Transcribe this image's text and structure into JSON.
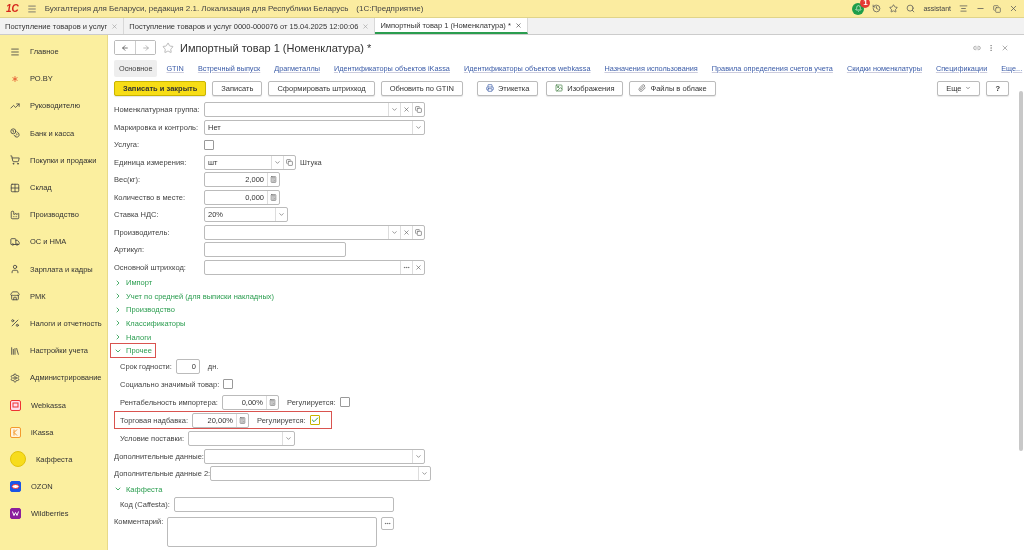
{
  "app_bar": {
    "logo": "1С",
    "title": "Бухгалтерия для Беларуси, редакция 2.1. Локализация для Республики Беларусь",
    "platform": "(1С:Предприятие)",
    "notification_count": "1",
    "user": "assistant"
  },
  "tabs": [
    {
      "label": "Поступление товаров и услуг",
      "selected": false
    },
    {
      "label": "Поступление товаров и услуг 0000-000076 от 15.04.2025 12:00:06",
      "selected": false
    },
    {
      "label": "Импортный товар 1 (Номенклатура) *",
      "selected": true
    }
  ],
  "sidebar": {
    "items": [
      {
        "label": "Главное"
      },
      {
        "label": "РО.BY"
      },
      {
        "label": "Руководителю"
      },
      {
        "label": "Банк и касса"
      },
      {
        "label": "Покупки и продажи"
      },
      {
        "label": "Склад"
      },
      {
        "label": "Производство"
      },
      {
        "label": "ОС и НМА"
      },
      {
        "label": "Зарплата и кадры"
      },
      {
        "label": "РМК"
      },
      {
        "label": "Налоги и отчетность"
      },
      {
        "label": "Настройки учета"
      },
      {
        "label": "Администрирование"
      },
      {
        "label": "Webkassa"
      },
      {
        "label": "iKassa"
      },
      {
        "label": "Каффеста"
      },
      {
        "label": "OZON"
      },
      {
        "label": "Wildberries"
      }
    ]
  },
  "form": {
    "title": "Импортный товар 1 (Номенклатура) *",
    "sections": [
      {
        "label": "Основное",
        "selected": true
      },
      {
        "label": "GTIN",
        "selected": false
      },
      {
        "label": "Встречный выпуск",
        "selected": false
      },
      {
        "label": "Драгметаллы",
        "selected": false
      },
      {
        "label": "Идентификаторы объектов iKassa",
        "selected": false
      },
      {
        "label": "Идентификаторы объектов webkassa",
        "selected": false
      },
      {
        "label": "Назначения использования",
        "selected": false
      },
      {
        "label": "Правила определения счетов учета",
        "selected": false
      },
      {
        "label": "Скидки номенклатуры",
        "selected": false
      },
      {
        "label": "Спецификации",
        "selected": false
      }
    ],
    "sections_more": "Еще...",
    "buttons": [
      {
        "label": "Записать и закрыть",
        "kind": "primary"
      },
      {
        "label": "Записать",
        "kind": "plain"
      },
      {
        "label": "Сформировать штрихкод",
        "kind": "plain"
      },
      {
        "label": "Обновить по GTIN",
        "kind": "plain"
      },
      {
        "label": "Этикетка",
        "kind": "print"
      },
      {
        "label": "Изображения",
        "kind": "image"
      },
      {
        "label": "Файлы в облаке",
        "kind": "clip"
      }
    ],
    "more_button": "Еще",
    "help_button": "?",
    "items": [
      {
        "kind": "ref",
        "label": "Номенклатурная группа:"
      },
      {
        "kind": "enum",
        "label": "Маркировка и контроль:",
        "value": "Нет"
      },
      {
        "kind": "check",
        "label": "Услуга:",
        "checked": false
      },
      {
        "kind": "unit",
        "label": "Единица измерения:",
        "value": "шт",
        "note": "Штука"
      },
      {
        "kind": "number",
        "label": "Вес(кг):",
        "value": "2,000"
      },
      {
        "kind": "number",
        "label": "Количество в месте:",
        "value": "0,000"
      },
      {
        "kind": "rate",
        "label": "Ставка НДС:",
        "value": "20%"
      },
      {
        "kind": "ref",
        "label": "Производитель:"
      },
      {
        "kind": "text",
        "label": "Артикул:"
      },
      {
        "kind": "barcode",
        "label": "Основной штрихкод:"
      },
      {
        "kind": "group",
        "label": "Импорт",
        "expanded": false,
        "highlighted": false
      },
      {
        "kind": "group",
        "label": "Учет по средней (для выписки накладных)",
        "expanded": false,
        "highlighted": false
      },
      {
        "kind": "group",
        "label": "Производство",
        "expanded": false,
        "highlighted": false
      },
      {
        "kind": "group",
        "label": "Классификаторы",
        "expanded": false,
        "highlighted": false
      },
      {
        "kind": "group",
        "label": "Налоги",
        "expanded": false,
        "highlighted": false
      },
      {
        "kind": "group",
        "label": "Прочее",
        "expanded": true,
        "highlighted": true,
        "children": [
          {
            "kind": "count",
            "label": "Срок годности:",
            "value": "0",
            "suffix": "дн.",
            "highlighted": false
          },
          {
            "kind": "check",
            "label": "Социально значимый товар:",
            "checked": false,
            "highlighted": false
          },
          {
            "kind": "number",
            "label": "Рентабельность импортера:",
            "value": "0,00%",
            "extra": {
              "label": "Регулируется:",
              "checked": false
            },
            "highlighted": false
          },
          {
            "kind": "number",
            "label": "Торговая надбавка:",
            "value": "20,00%",
            "extra": {
              "label": "Регулируется:",
              "checked": true
            },
            "highlighted": true
          },
          {
            "kind": "rate",
            "label": "Условие поставки:",
            "highlighted": false
          }
        ]
      },
      {
        "kind": "enum",
        "label": "Дополнительные данные:"
      },
      {
        "kind": "enum",
        "label": "Дополнительные данные 2:"
      },
      {
        "kind": "group",
        "label": "Каффеста",
        "expanded": true,
        "highlighted": false,
        "children": [
          {
            "kind": "text",
            "label": "Код (Caffesta):",
            "highlighted": false
          }
        ]
      },
      {
        "kind": "memo",
        "label": "Комментарий:"
      }
    ]
  }
}
